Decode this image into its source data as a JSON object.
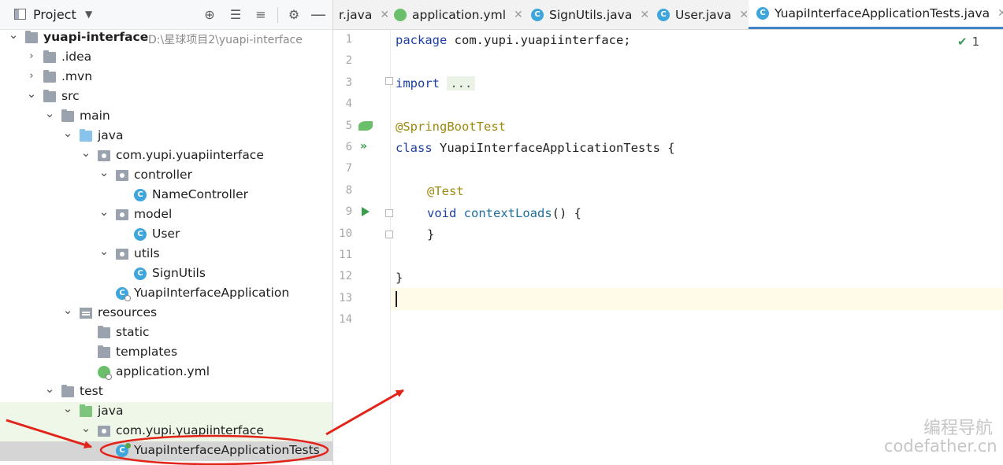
{
  "project_panel": {
    "title": "Project",
    "tree": [
      {
        "label": "yuapi-interface",
        "path": "D:\\星球项目2\\yuapi-interface",
        "depth": 0,
        "arrow": "down",
        "icon": "module-folder",
        "bold": true
      },
      {
        "label": ".idea",
        "depth": 1,
        "arrow": "right",
        "icon": "folder"
      },
      {
        "label": ".mvn",
        "depth": 1,
        "arrow": "right",
        "icon": "folder"
      },
      {
        "label": "src",
        "depth": 1,
        "arrow": "down",
        "icon": "folder"
      },
      {
        "label": "main",
        "depth": 2,
        "arrow": "down",
        "icon": "folder"
      },
      {
        "label": "java",
        "depth": 3,
        "arrow": "down",
        "icon": "source-folder"
      },
      {
        "label": "com.yupi.yuapiinterface",
        "depth": 4,
        "arrow": "down",
        "icon": "package"
      },
      {
        "label": "controller",
        "depth": 5,
        "arrow": "down",
        "icon": "package"
      },
      {
        "label": "NameController",
        "depth": 6,
        "arrow": "",
        "icon": "class"
      },
      {
        "label": "model",
        "depth": 5,
        "arrow": "down",
        "icon": "package"
      },
      {
        "label": "User",
        "depth": 6,
        "arrow": "",
        "icon": "class"
      },
      {
        "label": "utils",
        "depth": 5,
        "arrow": "down",
        "icon": "package"
      },
      {
        "label": "SignUtils",
        "depth": 6,
        "arrow": "",
        "icon": "class"
      },
      {
        "label": "YuapiInterfaceApplication",
        "depth": 5,
        "arrow": "",
        "icon": "spring-app-class"
      },
      {
        "label": "resources",
        "depth": 3,
        "arrow": "down",
        "icon": "resources-folder"
      },
      {
        "label": "static",
        "depth": 4,
        "arrow": "",
        "icon": "folder"
      },
      {
        "label": "templates",
        "depth": 4,
        "arrow": "",
        "icon": "folder"
      },
      {
        "label": "application.yml",
        "depth": 4,
        "arrow": "",
        "icon": "yaml-file"
      },
      {
        "label": "test",
        "depth": 2,
        "arrow": "down",
        "icon": "folder"
      },
      {
        "label": "java",
        "depth": 3,
        "arrow": "down",
        "icon": "test-folder",
        "tint": true
      },
      {
        "label": "com.yupi.yuapiinterface",
        "depth": 4,
        "arrow": "down",
        "icon": "package",
        "tint": true
      },
      {
        "label": "YuapiInterfaceApplicationTests",
        "depth": 5,
        "arrow": "",
        "icon": "test-class",
        "selected": true
      }
    ]
  },
  "editor": {
    "tabs": [
      {
        "label": "r.java",
        "icon": "",
        "active": false
      },
      {
        "label": "application.yml",
        "icon": "yaml-file",
        "active": false
      },
      {
        "label": "SignUtils.java",
        "icon": "class",
        "active": false
      },
      {
        "label": "User.java",
        "icon": "class",
        "active": false
      },
      {
        "label": "YuapiInterfaceApplicationTests.java",
        "icon": "test-class",
        "active": true
      }
    ],
    "line_numbers": [
      "1",
      "2",
      "3",
      "4",
      "5",
      "6",
      "7",
      "8",
      "9",
      "10",
      "11",
      "12",
      "13",
      "14"
    ],
    "code": {
      "l1_kw": "package",
      "l1_rest": " com.yupi.yuapiinterface;",
      "l3_kw": "import",
      "l3_dots": "...",
      "l6_ann": "@SpringBootTest",
      "l7_kw": "class",
      "l7_rest": " YuapiInterfaceApplicationTests {",
      "l9_ann": "@Test",
      "l10_kw": "void",
      "l10_fn": "contextLoads",
      "l10_rest": "() {",
      "l11": "}",
      "l13": "}"
    },
    "inspection": {
      "icon": "check-icon",
      "count": "1"
    }
  },
  "watermark": {
    "line1": "编程导航",
    "line2": "codefather.cn"
  },
  "colors": {
    "annotation_red": "#e2231a",
    "active_tab_underline": "#4083c9"
  }
}
